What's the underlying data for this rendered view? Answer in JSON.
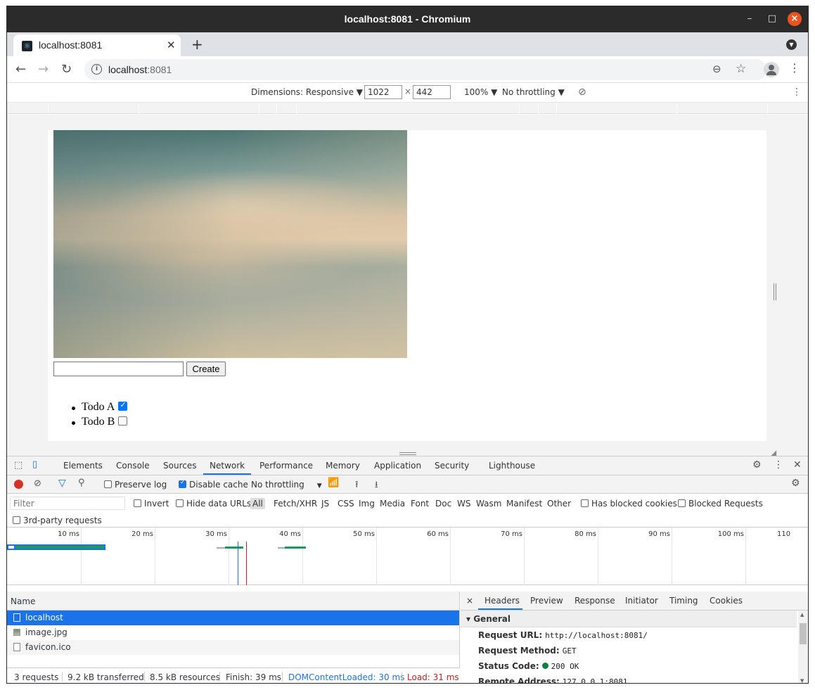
{
  "window": {
    "title": "localhost:8081 - Chromium"
  },
  "tab": {
    "title": "localhost:8081"
  },
  "omnibox": {
    "host": "localhost",
    "port": ":8081"
  },
  "device_toolbar": {
    "dimensions_label": "Dimensions: Responsive ▼",
    "width": "1022",
    "times": "×",
    "height": "442",
    "zoom": "100% ▼",
    "throttling": "No throttling ▼"
  },
  "page": {
    "create_label": "Create",
    "todos": [
      {
        "label": "Todo A",
        "checked": true
      },
      {
        "label": "Todo B",
        "checked": false
      }
    ]
  },
  "devtools": {
    "tabs": [
      "Elements",
      "Console",
      "Sources",
      "Network",
      "Performance",
      "Memory",
      "Application",
      "Security",
      "Lighthouse"
    ],
    "active_tab": "Network",
    "toolbar": {
      "preserve_log": "Preserve log",
      "disable_cache": "Disable cache",
      "throttling": "No throttling",
      "throttling_arrow": "▼"
    },
    "filter": {
      "placeholder": "Filter",
      "invert": "Invert",
      "hide_data_urls": "Hide data URLs",
      "types": [
        "All",
        "Fetch/XHR",
        "JS",
        "CSS",
        "Img",
        "Media",
        "Font",
        "Doc",
        "WS",
        "Wasm",
        "Manifest",
        "Other"
      ],
      "has_blocked_cookies": "Has blocked cookies",
      "blocked_requests": "Blocked Requests",
      "third_party": "3rd-party requests"
    },
    "timeline_ticks": [
      "10 ms",
      "20 ms",
      "30 ms",
      "40 ms",
      "50 ms",
      "60 ms",
      "70 ms",
      "80 ms",
      "90 ms",
      "100 ms",
      "110"
    ],
    "requests": {
      "column_name": "Name",
      "rows": [
        "localhost",
        "image.jpg",
        "favicon.ico"
      ]
    },
    "status": {
      "requests": "3 requests",
      "transferred": "9.2 kB transferred",
      "resources": "8.5 kB resources",
      "finish": "Finish: 39 ms",
      "dom_content_loaded": "DOMContentLoaded: 30 ms",
      "load": "Load: 31 ms"
    },
    "details": {
      "close": "×",
      "tabs": [
        "Headers",
        "Preview",
        "Response",
        "Initiator",
        "Timing",
        "Cookies"
      ],
      "section": "▾ General",
      "request_url_label": "Request URL:",
      "request_url": "http://localhost:8081/",
      "request_method_label": "Request Method:",
      "request_method": "GET",
      "status_code_label": "Status Code:",
      "status_code": "200 OK",
      "remote_address_label": "Remote Address:",
      "remote_address": "127.0.0.1:8081"
    }
  }
}
